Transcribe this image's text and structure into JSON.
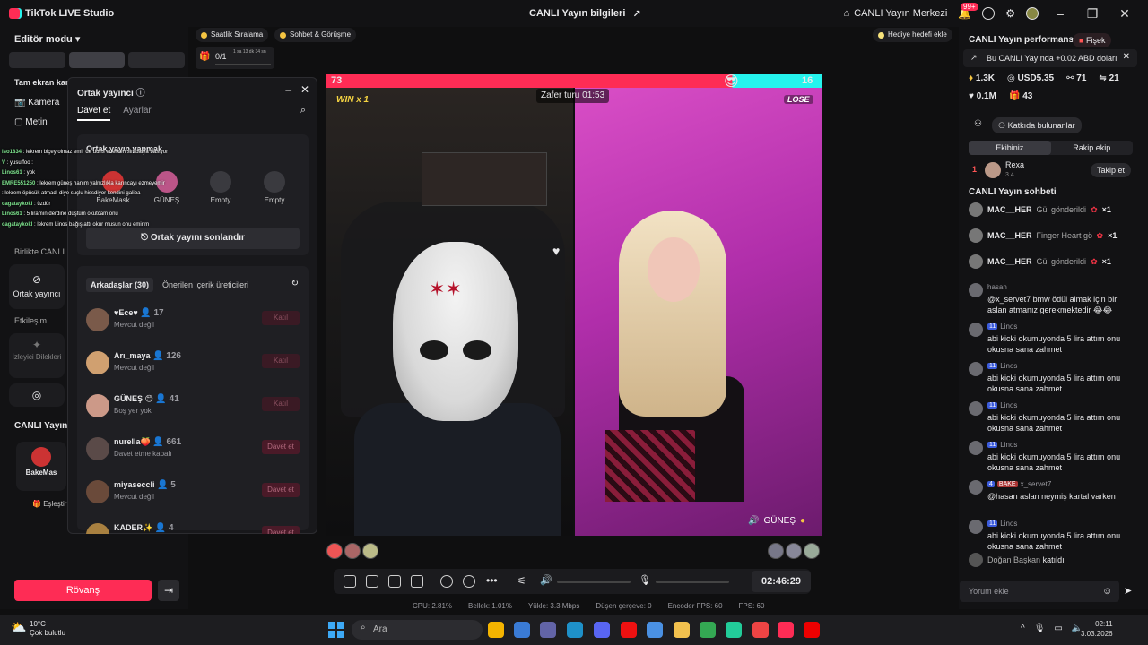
{
  "app": {
    "title": "TikTok LIVE Studio",
    "center_title": "CANLI Yayın bilgileri",
    "live_center": "CANLI Yayın Merkezi",
    "notif_badge": "99+"
  },
  "left": {
    "editor_mode": "Editör modu",
    "fullscreen": "Tam ekran kar",
    "camera": "Kamera",
    "text": "Metin",
    "together": "Birlikte CANLI",
    "cohost": "Ortak yayıncı",
    "interaction": "Etkileşim",
    "viewer_wishes": "İzleyici Dilekleri",
    "live_yayin": "CANLI Yayın",
    "bakemask_short": "BakeMas",
    "match": "Eşleştir",
    "rematch": "Rövanş",
    "overlay_chat": [
      {
        "user": "iso1834",
        "text": "lekrem biçey olmaz emir de duns ederken simba ya basıyor"
      },
      {
        "user": "V",
        "text": "yusuffoo :"
      },
      {
        "user": "Linos61",
        "text": "yok"
      },
      {
        "user": "EMRE551250",
        "text": "lekrem güneş hanım yalnızlıkla karıncayı ezmeyemir"
      },
      {
        "user": "",
        "text": "lekrem öpücük atmadı diye suçlu hissdiyor kendini galiba"
      },
      {
        "user": "cagataykokl",
        "text": "üzdür"
      },
      {
        "user": "Linos61",
        "text": "5 liramın derdine düştüm okutcam onu"
      },
      {
        "user": "cagataykokl",
        "text": "lekrem Linos bağış attı okur musun onu emirim"
      }
    ]
  },
  "modal": {
    "title": "Ortak yayıncı",
    "tab_invite": "Davet et",
    "tab_settings": "Ayarlar",
    "section_title": "Ortak yayın yapmak",
    "slots": [
      "BakeMask",
      "GÜNEŞ",
      "Empty",
      "Empty"
    ],
    "end_button": "Ortak yayını sonlandır",
    "friends_tab": "Arkadaşlar (30)",
    "suggested_tab": "Önerilen içerik üreticileri",
    "friends": [
      {
        "name": "Ece",
        "count": "17",
        "status": "Mevcut değil",
        "action": "Katıl"
      },
      {
        "name": "Arı_maya",
        "count": "126",
        "status": "Mevcut değil",
        "action": "Katıl"
      },
      {
        "name": "GÜNEŞ",
        "count": "41",
        "status": "Boş yer yok",
        "action": "Katıl"
      },
      {
        "name": "nurella",
        "count": "661",
        "status": "Davet etme kapalı",
        "action": "Davet et"
      },
      {
        "name": "miyaseccli",
        "count": "5",
        "status": "Mevcut değil",
        "action": "Davet et"
      },
      {
        "name": "KADER",
        "count": "4",
        "status": "",
        "action": "Davet et"
      }
    ]
  },
  "top": {
    "hourly": "Saatlik Sıralama",
    "chat_meet": "Sohbet & Görüşme",
    "progress": "0/1",
    "progress_time": "1 sa 13 dk 34 sn",
    "add_goal": "Hediye hedefi ekle"
  },
  "battle": {
    "score_left": "73",
    "score_right": "16",
    "timer": "Zafer turu 01:53",
    "win": "WIN x 1",
    "lose": "LOSE",
    "right_name": "GÜNEŞ",
    "left_score_ratio": 0.82
  },
  "controls": {
    "clock": "02:46:29"
  },
  "stats": {
    "cpu": "CPU: 2.81%",
    "mem": "Bellek: 1.01%",
    "upload": "Yükle: 3.3 Mbps",
    "dropped": "Düşen çerçeve: 0",
    "encoder": "Encoder FPS: 60",
    "fps": "FPS: 60"
  },
  "right": {
    "perf_title": "CANLI Yayın performansı",
    "firework": "Fişek",
    "earn_note": "Bu CANLI Yayında +0.02 ABD doları",
    "m_likes": "1.3K",
    "m_usd": "USD5.35",
    "m_a": "71",
    "m_b": "21",
    "m_c": "0.1M",
    "m_d": "43",
    "contributors": "Katkıda bulunanlar",
    "team_tab": "Ekibiniz",
    "rival_tab": "Rakip ekip",
    "rank": "1",
    "rank_user": "Rexa",
    "rank_meta": "3   4",
    "follow": "Takip et",
    "chat_title": "CANLI Yayın sohbeti",
    "gifts": [
      {
        "user": "MAC__HER",
        "text": "Gül gönderildi",
        "count": "×1"
      },
      {
        "user": "MAC__HER",
        "text": "Finger Heart gönd",
        "count": "×1"
      },
      {
        "user": "MAC__HER",
        "text": "Gül gönderildi",
        "count": "×1"
      }
    ],
    "messages": [
      {
        "user": "hasan",
        "lvl": "",
        "text": "@x_servet7 bmw ödül almak için bir aslan atmanız gerekmektedir 😂😂"
      },
      {
        "user": "Linos",
        "lvl": "11",
        "text": "abi kicki okumuyonda 5 lira attım onu okusna sana zahmet"
      },
      {
        "user": "Linos",
        "lvl": "11",
        "text": "abi kicki okumuyonda 5 lira attım onu okusna sana zahmet"
      },
      {
        "user": "Linos",
        "lvl": "11",
        "text": "abi kicki okumuyonda 5 lira attım onu okusna sana zahmet"
      },
      {
        "user": "Linos",
        "lvl": "11",
        "text": "abi kicki okumuyonda 5 lira attım onu okusna sana zahmet"
      },
      {
        "user": "x_servet7",
        "lvl": "4",
        "text": "@hasan aslan neymiş kartal varken"
      },
      {
        "user": "Linos",
        "lvl": "11",
        "text": "abi kicki okumuyonda 5 lira attım onu okusna sana zahmet"
      }
    ],
    "join_user": "Doğan Başkan",
    "join_text": "katıldı",
    "bake_badge": "BAKE",
    "comment_placeholder": "Yorum ekle"
  },
  "taskbar": {
    "temp": "10°C",
    "weather": "Çok bulutlu",
    "search": "Ara",
    "time": "02:11",
    "date": "3.03.2026"
  }
}
